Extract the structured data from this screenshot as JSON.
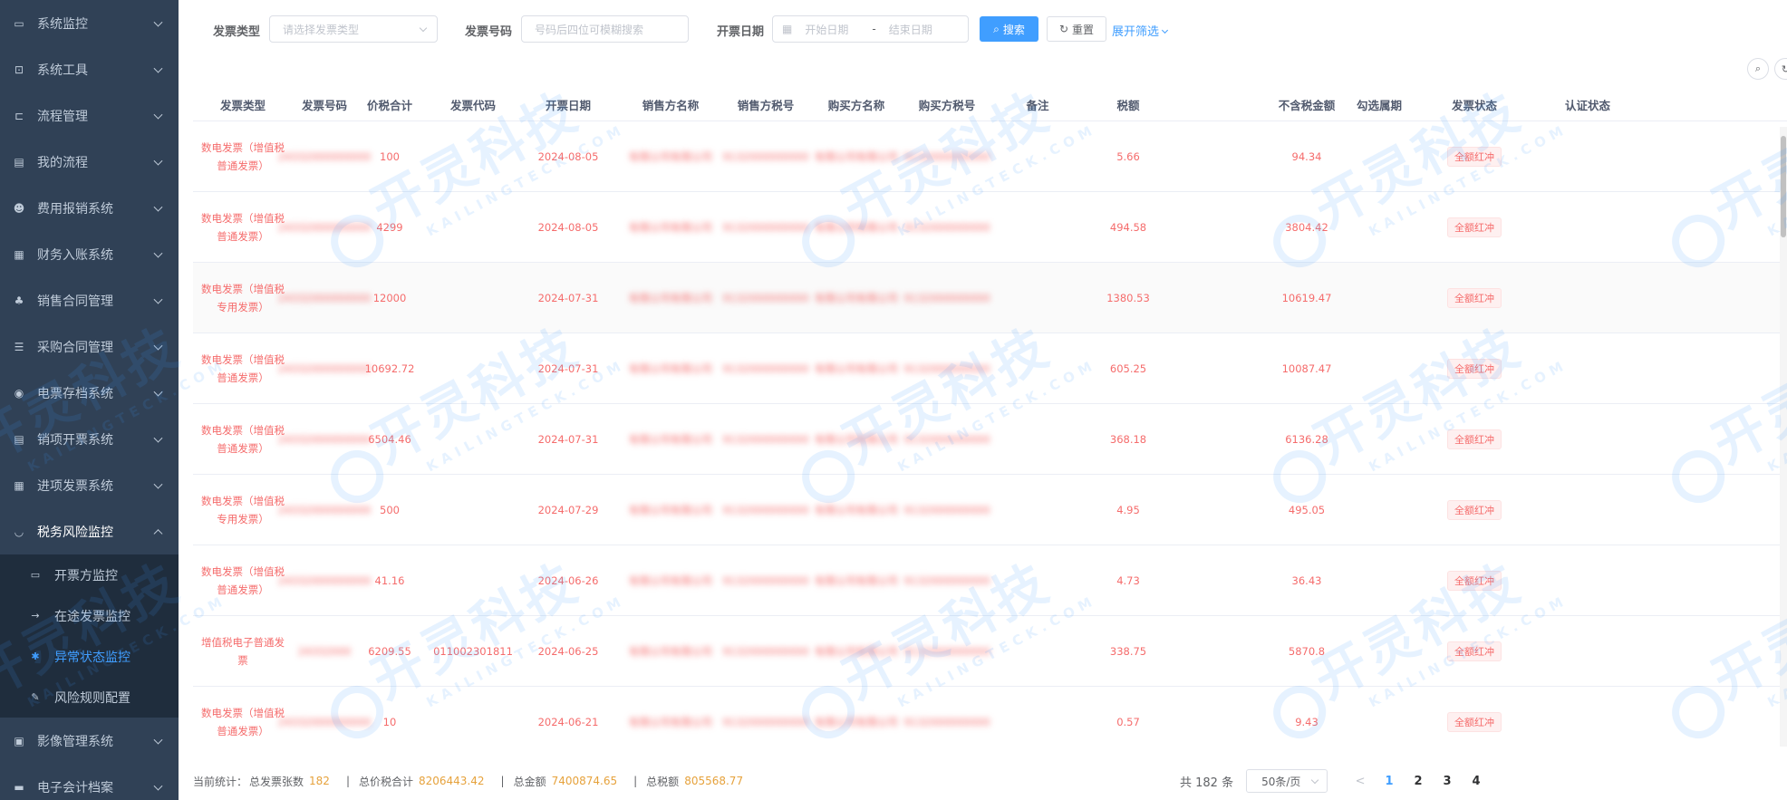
{
  "sidebar": {
    "items": [
      {
        "label": "系统监控",
        "icon": "monitor-icon",
        "glyph": "▭"
      },
      {
        "label": "系统工具",
        "icon": "toolbox-icon",
        "glyph": "⊡"
      },
      {
        "label": "流程管理",
        "icon": "flow-icon",
        "glyph": "⊏"
      },
      {
        "label": "我的流程",
        "icon": "list-icon",
        "glyph": "▤"
      },
      {
        "label": "费用报销系统",
        "icon": "user-money-icon",
        "glyph": "☻"
      },
      {
        "label": "财务入账系统",
        "icon": "grid-icon",
        "glyph": "▦"
      },
      {
        "label": "销售合同管理",
        "icon": "tree-icon",
        "glyph": "♣"
      },
      {
        "label": "采购合同管理",
        "icon": "list-check-icon",
        "glyph": "☰"
      },
      {
        "label": "电票存档系统",
        "icon": "archive-icon",
        "glyph": "◉"
      },
      {
        "label": "销项开票系统",
        "icon": "invoice-icon",
        "glyph": "▤"
      },
      {
        "label": "进项发票系统",
        "icon": "table-icon",
        "glyph": "▦"
      },
      {
        "label": "税务风险监控",
        "icon": "eye-icon",
        "glyph": "◡"
      }
    ],
    "subitems": [
      {
        "label": "开票方监控",
        "icon": "chat-icon",
        "glyph": "▭"
      },
      {
        "label": "在途发票监控",
        "icon": "route-icon",
        "glyph": "→"
      },
      {
        "label": "异常状态监控",
        "icon": "bug-icon",
        "glyph": "✱"
      },
      {
        "label": "风险规则配置",
        "icon": "edit-doc-icon",
        "glyph": "✎"
      }
    ],
    "after": [
      {
        "label": "影像管理系统",
        "icon": "image-icon",
        "glyph": "▣"
      },
      {
        "label": "电子会计档案",
        "icon": "folder-icon",
        "glyph": "▬"
      }
    ]
  },
  "filters": {
    "invoice_type_label": "发票类型",
    "invoice_type_placeholder": "请选择发票类型",
    "invoice_no_label": "发票号码",
    "invoice_no_placeholder": "号码后四位可模糊搜索",
    "date_label": "开票日期",
    "date_start_placeholder": "开始日期",
    "date_sep": "-",
    "date_end_placeholder": "结束日期",
    "search_label": "搜索",
    "reset_label": "重置",
    "expand_label": "展开筛选"
  },
  "table": {
    "columns": [
      "发票类型",
      "发票号码",
      "价税合计",
      "发票代码",
      "开票日期",
      "销售方名称",
      "销售方税号",
      "购买方名称",
      "购买方税号",
      "备注",
      "税额",
      "不含税金额",
      "勾选属期",
      "发票状态",
      "认证状态"
    ],
    "rows": [
      {
        "type": "数电发票（增值税普通发票）",
        "no": "24332000000000",
        "total": "100",
        "code": "",
        "date": "2024-08-05",
        "seller": "有限公司有限公司",
        "seller_tax": "9132000000000",
        "buyer": "有限公司有限公司",
        "buyer_tax": "9132000000000",
        "note": "",
        "tax": "5.66",
        "net": "94.34",
        "period": "",
        "status": "全额红冲",
        "auth": ""
      },
      {
        "type": "数电发票（增值税普通发票）",
        "no": "24332000000000",
        "total": "4299",
        "code": "",
        "date": "2024-08-05",
        "seller": "有限公司有限公司",
        "seller_tax": "9132000000000",
        "buyer": "有限公司有限公司",
        "buyer_tax": "9132000000000",
        "note": "",
        "tax": "494.58",
        "net": "3804.42",
        "period": "",
        "status": "全额红冲",
        "auth": ""
      },
      {
        "type": "数电发票（增值税专用发票）",
        "no": "24332000000000",
        "total": "12000",
        "code": "",
        "date": "2024-07-31",
        "seller": "有限公司有限公司",
        "seller_tax": "9132000000000",
        "buyer": "有限公司有限公司",
        "buyer_tax": "9132000000000",
        "note": "",
        "tax": "1380.53",
        "net": "10619.47",
        "period": "",
        "status": "全额红冲",
        "auth": ""
      },
      {
        "type": "数电发票（增值税普通发票）",
        "no": "24332000000000",
        "total": "10692.72",
        "code": "",
        "date": "2024-07-31",
        "seller": "有限公司有限公司",
        "seller_tax": "9132000000000",
        "buyer": "有限公司有限公司",
        "buyer_tax": "9132000000000",
        "note": "",
        "tax": "605.25",
        "net": "10087.47",
        "period": "",
        "status": "全额红冲",
        "auth": ""
      },
      {
        "type": "数电发票（增值税普通发票）",
        "no": "24332000000000",
        "total": "6504.46",
        "code": "",
        "date": "2024-07-31",
        "seller": "有限公司有限公司",
        "seller_tax": "9132000000000",
        "buyer": "有限公司有限公司",
        "buyer_tax": "9132000000000",
        "note": "",
        "tax": "368.18",
        "net": "6136.28",
        "period": "",
        "status": "全额红冲",
        "auth": ""
      },
      {
        "type": "数电发票（增值税专用发票）",
        "no": "24332000000000",
        "total": "500",
        "code": "",
        "date": "2024-07-29",
        "seller": "有限公司有限公司",
        "seller_tax": "9132000000000",
        "buyer": "有限公司有限公司",
        "buyer_tax": "9132000000000",
        "note": "",
        "tax": "4.95",
        "net": "495.05",
        "period": "",
        "status": "全额红冲",
        "auth": ""
      },
      {
        "type": "数电发票（增值税普通发票）",
        "no": "24332000000000",
        "total": "41.16",
        "code": "",
        "date": "2024-06-26",
        "seller": "有限公司有限公司",
        "seller_tax": "9132000000000",
        "buyer": "有限公司有限公司",
        "buyer_tax": "9132000000000",
        "note": "",
        "tax": "4.73",
        "net": "36.43",
        "period": "",
        "status": "全额红冲",
        "auth": ""
      },
      {
        "type": "增值税电子普通发票",
        "no": "24332000",
        "total": "6209.55",
        "code": "011002301811",
        "date": "2024-06-25",
        "seller": "有限公司有限公司",
        "seller_tax": "9132000000000",
        "buyer": "有限公司有限公司",
        "buyer_tax": "9132000000000",
        "note": "",
        "tax": "338.75",
        "net": "5870.8",
        "period": "",
        "status": "全额红冲",
        "auth": ""
      },
      {
        "type": "数电发票（增值税普通发票）",
        "no": "24332000000000",
        "total": "10",
        "code": "",
        "date": "2024-06-21",
        "seller": "有限公司有限公司",
        "seller_tax": "9132000000000",
        "buyer": "有限公司有限公司",
        "buyer_tax": "9132000000000",
        "note": "",
        "tax": "0.57",
        "net": "9.43",
        "period": "",
        "status": "全额红冲",
        "auth": ""
      }
    ]
  },
  "footer": {
    "prefix": "当前统计：",
    "count_label": "总发票张数",
    "count": "182",
    "total_label": "总价税合计",
    "total": "8206443.42",
    "net_label": "总金额",
    "net": "7400874.65",
    "tax_label": "总税额",
    "tax": "805568.77",
    "sep": "|"
  },
  "pagination": {
    "total_text": "共 182 条",
    "page_size": "50条/页",
    "prev": "<",
    "pages": [
      "1",
      "2",
      "3",
      "4"
    ],
    "current": "1"
  },
  "watermark": {
    "text": "开灵科技",
    "sub": "KAILINGTECK.COM"
  },
  "colors": {
    "sidebar_bg": "#304156",
    "submenu_bg": "#1f2d3d",
    "accent": "#409eff",
    "danger": "#f56c6c",
    "warning": "#e6a23c"
  }
}
